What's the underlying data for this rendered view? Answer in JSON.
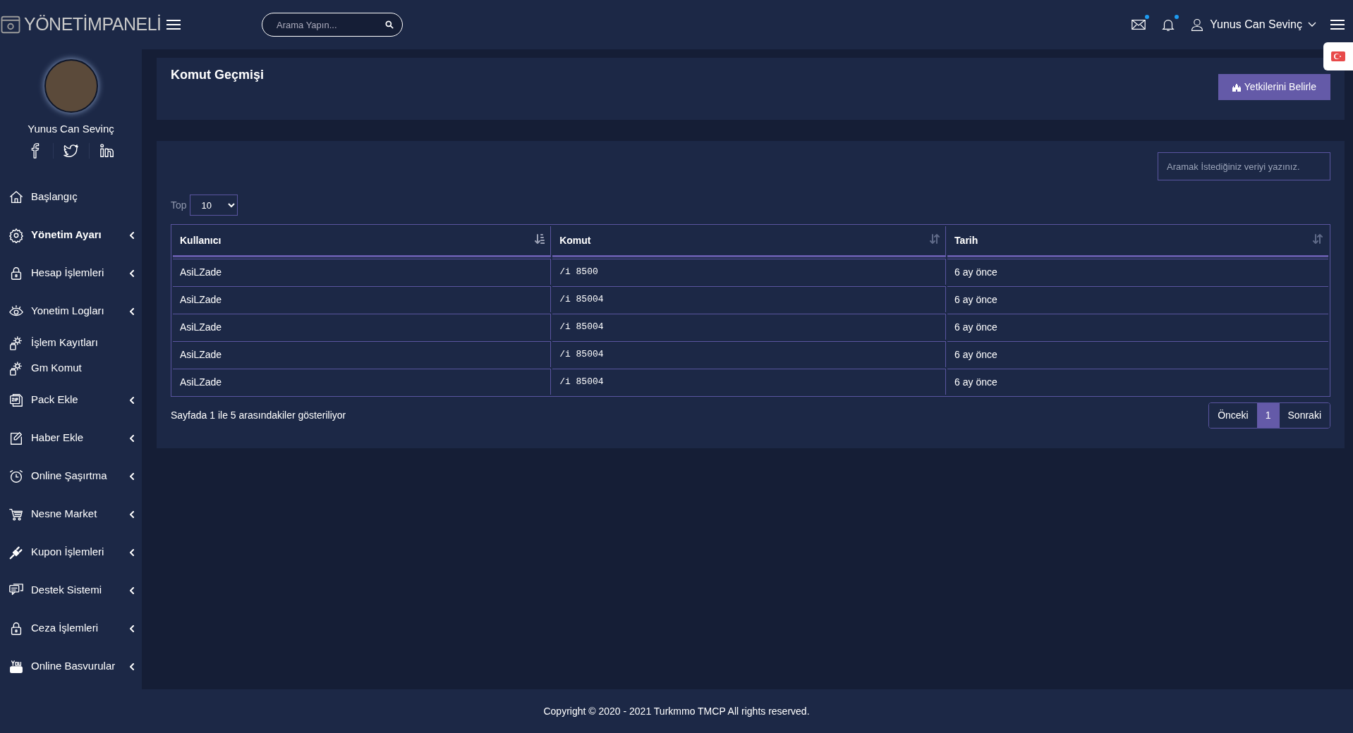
{
  "brand": {
    "bold": "YÖNETİM",
    "light": "PANELİ"
  },
  "header": {
    "search_placeholder": "Arama Yapın...",
    "user_name": "Yunus Can Sevinç",
    "mail_unread": true,
    "bell_unread": true
  },
  "profile": {
    "name": "Yunus Can Sevinç"
  },
  "sidebar": {
    "items": [
      {
        "label": "Başlangıç",
        "kind": "home",
        "expandable": false,
        "selected": false
      },
      {
        "label": "Yönetim Ayarı",
        "kind": "gear",
        "expandable": true,
        "selected": true
      },
      {
        "label": "Hesap İşlemleri",
        "kind": "lock",
        "expandable": true,
        "selected": false
      },
      {
        "label": "Yonetim Logları",
        "kind": "eye",
        "expandable": true,
        "selected": false
      },
      {
        "label": "İşlem Kayıtları",
        "kind": "gears",
        "expandable": false,
        "selected": false
      },
      {
        "label": "Gm Komut",
        "kind": "gears",
        "expandable": false,
        "selected": false
      },
      {
        "label": "Pack Ekle",
        "kind": "zip",
        "expandable": true,
        "selected": false
      },
      {
        "label": "Haber Ekle",
        "kind": "edit",
        "expandable": true,
        "selected": false
      },
      {
        "label": "Online Şaşırtma",
        "kind": "alarm",
        "expandable": true,
        "selected": false
      },
      {
        "label": "Nesne Market",
        "kind": "cart",
        "expandable": true,
        "selected": false
      },
      {
        "label": "Kupon İşlemleri",
        "kind": "plug",
        "expandable": true,
        "selected": false
      },
      {
        "label": "Destek Sistemi",
        "kind": "chat",
        "expandable": true,
        "selected": false
      },
      {
        "label": "Ceza İşlemleri",
        "kind": "lock",
        "expandable": true,
        "selected": false
      },
      {
        "label": "Online Basvurular",
        "kind": "video",
        "expandable": true,
        "selected": false
      }
    ]
  },
  "page": {
    "title": "Komut Geçmişi",
    "action": "Yetkilerini Belirle"
  },
  "table_card": {
    "search_placeholder": "Aramak İstediğiniz veriyi yazınız.",
    "length_label": "Top",
    "length_value": "10",
    "columns": [
      {
        "label": "Kullanıcı",
        "sorted": true,
        "mono": false
      },
      {
        "label": "Komut",
        "sorted": false,
        "mono": true
      },
      {
        "label": "Tarih",
        "sorted": false,
        "mono": false
      }
    ],
    "rows": [
      [
        "AsiLZade",
        "/i 8500",
        "6 ay önce"
      ],
      [
        "AsiLZade",
        "/i 85004",
        "6 ay önce"
      ],
      [
        "AsiLZade",
        "/i 85004",
        "6 ay önce"
      ],
      [
        "AsiLZade",
        "/i 85004",
        "6 ay önce"
      ],
      [
        "AsiLZade",
        "/i 85004",
        "6 ay önce"
      ]
    ],
    "info": "Sayfada 1 ile 5 arasındakiler gösteriliyor",
    "pagination": [
      {
        "label": "Önceki",
        "selected": false
      },
      {
        "label": "1",
        "selected": true
      },
      {
        "label": "Sonraki",
        "selected": false
      }
    ]
  },
  "footer": "Copyright © 2020 - 2021 Turkmmo TMCP All rights reserved."
}
